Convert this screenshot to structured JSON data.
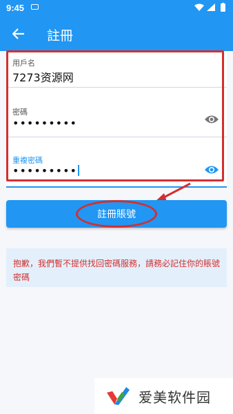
{
  "status_bar": {
    "time": "9:45"
  },
  "app_bar": {
    "title": "註冊"
  },
  "form": {
    "username_label": "用戶名",
    "username_value": "7273资源网",
    "password_label": "密碼",
    "password_value": "•••••••••",
    "confirm_label": "重複密碼",
    "confirm_value": "•••••••••"
  },
  "register_button": {
    "label": "註冊賬號"
  },
  "notice": {
    "text": "抱歉，我們暫不提供找回密碼服務，請務必記住你的賬號密碼"
  },
  "watermark": {
    "text": "爱美软件园"
  },
  "colors": {
    "primary": "#2196f3",
    "annotation_red": "#d32f2f",
    "notice_bg": "#e3f0fb"
  }
}
